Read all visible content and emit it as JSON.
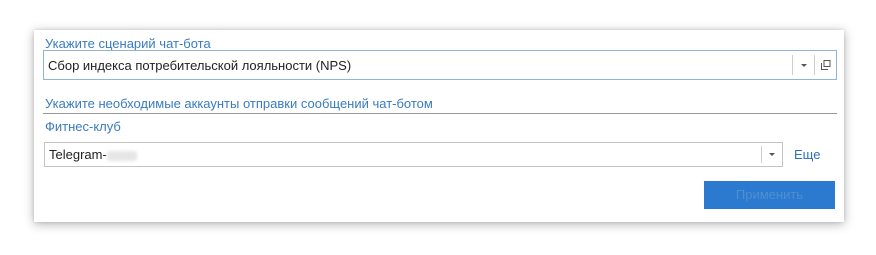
{
  "scenario": {
    "label": "Укажите сценарий чат-бота",
    "selected": "Сбор индекса потребительской лояльности (NPS)"
  },
  "accounts": {
    "label": "Укажите необходимые аккаунты отправки сообщений чат-ботом",
    "group_label": "Фитнес-клуб",
    "selected_prefix": "Telegram-",
    "more_label": "Еще"
  },
  "apply_label": "Применить",
  "colors": {
    "label_blue": "#3a7bc0",
    "focus_border": "#8fb5dc",
    "apply_bg": "#2c7ad0"
  },
  "icons": {
    "dropdown": "chevron-down-icon",
    "open_window": "open-window-icon"
  }
}
